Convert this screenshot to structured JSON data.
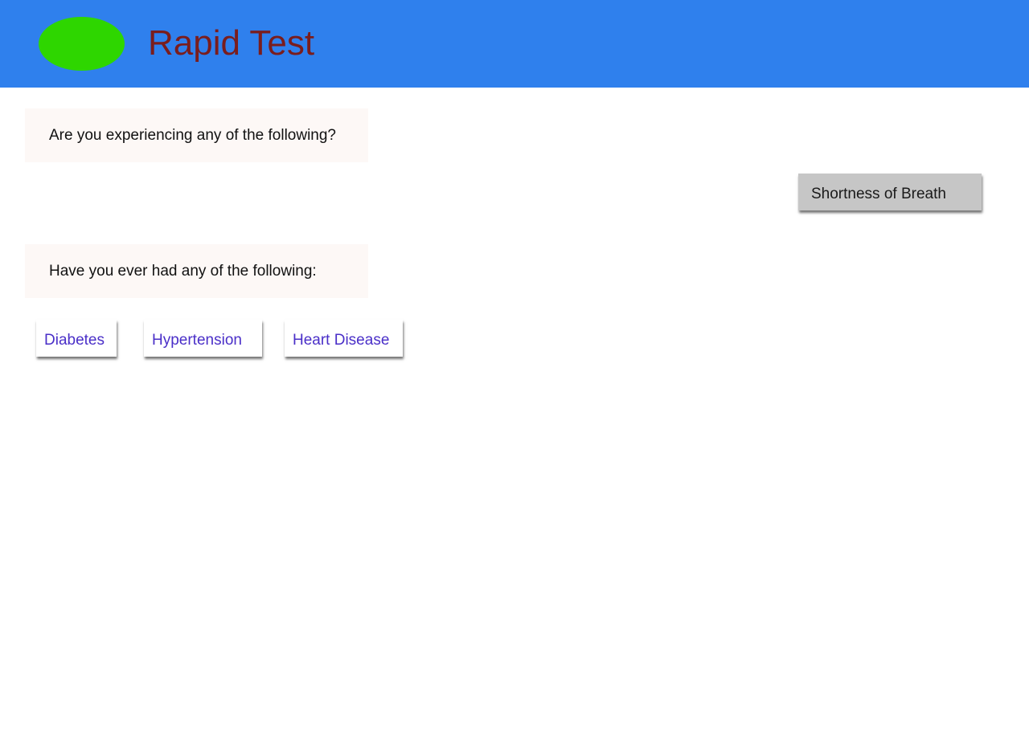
{
  "header": {
    "title": "Rapid Test",
    "logo_color": "#2ed600",
    "background_color": "#2f80ed"
  },
  "symptoms_section": {
    "question": "Are you experiencing any of the following?",
    "options": [
      {
        "label": "Shortness of Breath"
      }
    ]
  },
  "history_section": {
    "question": "Have you ever had any of the following:",
    "options": [
      {
        "label": "Diabetes"
      },
      {
        "label": "Hypertension"
      },
      {
        "label": "Heart Disease"
      }
    ]
  }
}
